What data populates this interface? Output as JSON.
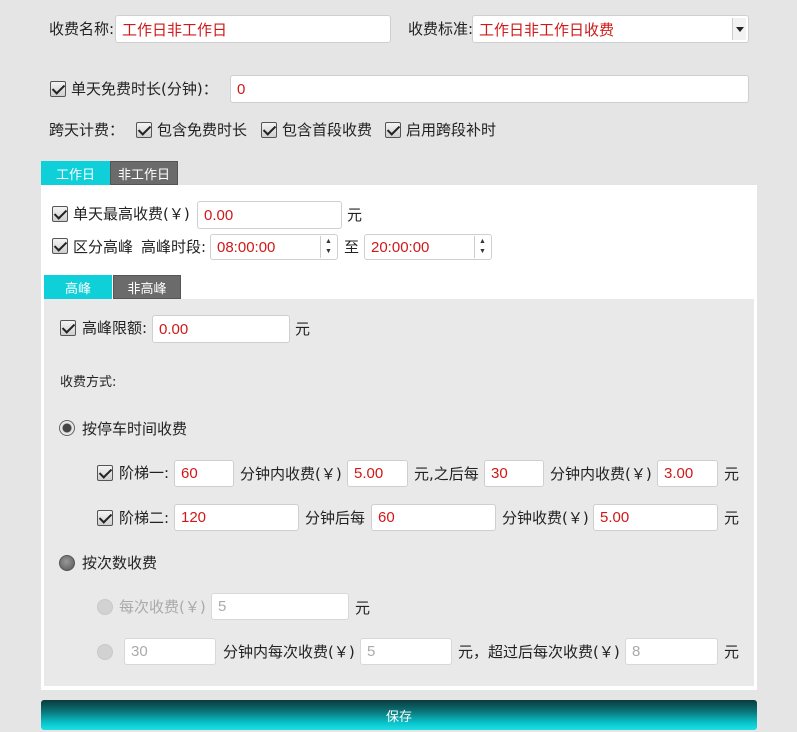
{
  "header": {
    "name_label": "收费名称:",
    "name_value": "工作日非工作日",
    "standard_label": "收费标准:",
    "standard_value": "工作日非工作日收费"
  },
  "free_time": {
    "label": "单天免费时长(分钟)：",
    "value": "0",
    "checked": true
  },
  "cross_day": {
    "label": "跨天计费：",
    "options": [
      {
        "label": "包含免费时长",
        "checked": true
      },
      {
        "label": "包含首段收费",
        "checked": true
      },
      {
        "label": "启用跨段补时",
        "checked": true
      }
    ]
  },
  "day_tabs": [
    {
      "label": "工作日",
      "active": true
    },
    {
      "label": "非工作日",
      "active": false
    }
  ],
  "daily_max": {
    "label": "单天最高收费(￥)",
    "value": "0.00",
    "unit": "元"
  },
  "peak": {
    "label": "区分高峰",
    "period_label": "高峰时段:",
    "start": "08:00:00",
    "to": "至",
    "end": "20:00:00"
  },
  "peak_tabs": [
    {
      "label": "高峰",
      "active": true
    },
    {
      "label": "非高峰",
      "active": false
    }
  ],
  "peak_limit": {
    "label": "高峰限额:",
    "value": "0.00",
    "unit": "元"
  },
  "method_label": "收费方式:",
  "by_time": {
    "label": "按停车时间收费",
    "tier1": {
      "label": "阶梯一:",
      "minutes": "60",
      "text1": "分钟内收费(￥)",
      "fee": "5.00",
      "text2": "元,之后每",
      "minutes2": "30",
      "text3": "分钟内收费(￥)",
      "fee2": "3.00",
      "unit": "元"
    },
    "tier2": {
      "label": "阶梯二:",
      "minutes": "120",
      "text1": "分钟后每",
      "minutes2": "60",
      "text2": "分钟收费(￥)",
      "fee": "5.00",
      "unit": "元"
    }
  },
  "by_count": {
    "label": "按次数收费",
    "per_time_label": "每次收费(￥)",
    "per_time_value": "5",
    "per_time_unit": "元",
    "window_minutes": "30",
    "window_text": "分钟内每次收费(￥)",
    "window_fee": "5",
    "window_text2": "元，超过后每次收费(￥)",
    "over_fee": "8",
    "unit": "元"
  },
  "save_label": "保存"
}
